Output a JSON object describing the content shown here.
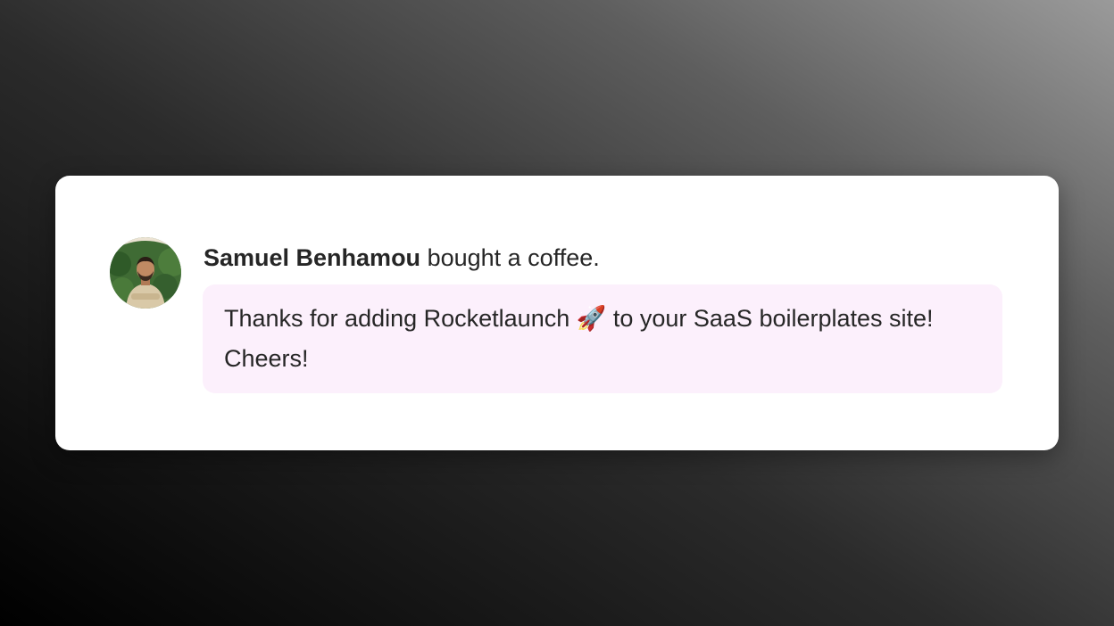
{
  "notification": {
    "supporter_name": "Samuel Benhamou",
    "action_text": "bought a coffee.",
    "message": "Thanks for adding Rocketlaunch 🚀 to your SaaS boilerplates site! Cheers!",
    "avatar_icon": "user-avatar-photo",
    "message_bg_color": "#fcf0fc"
  }
}
